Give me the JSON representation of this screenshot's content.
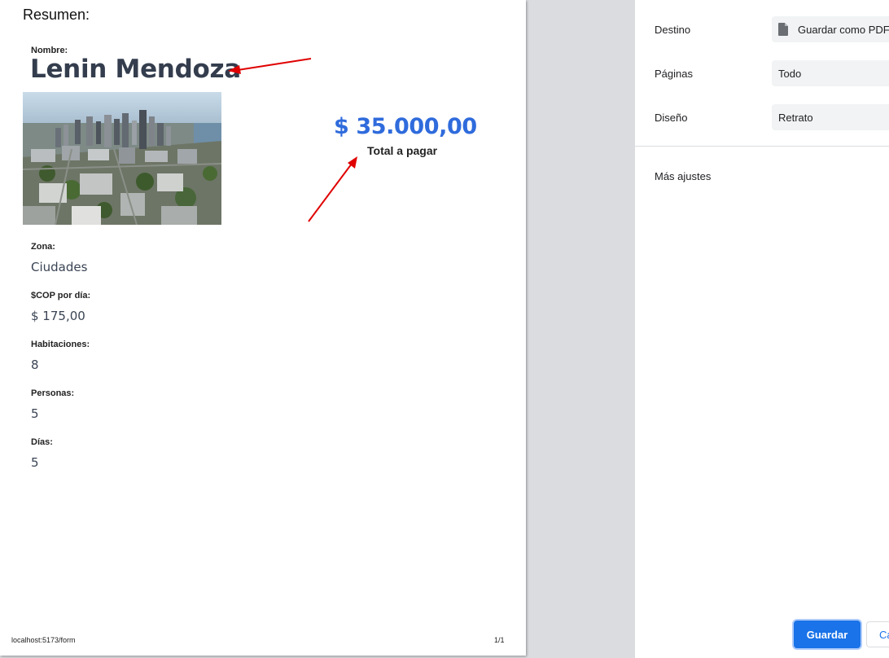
{
  "document": {
    "heading": "Resumen:",
    "name_label": "Nombre:",
    "name_value": "Lenin Mendoza",
    "total_amount": "$ 35.000,00",
    "total_label": "Total a pagar",
    "fields": [
      {
        "label": "Zona:",
        "value": "Ciudades"
      },
      {
        "label": "$COP por día:",
        "value": "$ 175,00"
      },
      {
        "label": "Habitaciones:",
        "value": "8"
      },
      {
        "label": "Personas:",
        "value": "5"
      },
      {
        "label": "Días:",
        "value": "5"
      }
    ],
    "image": "city-aerial-photo",
    "footer_url": "localhost:5173/form",
    "footer_page": "1/1"
  },
  "print_settings": {
    "destination_label": "Destino",
    "destination_value": "Guardar como PDF",
    "pages_label": "Páginas",
    "pages_value": "Todo",
    "layout_label": "Diseño",
    "layout_value": "Retrato",
    "more_settings": "Más ajustes",
    "save_button": "Guardar",
    "cancel_button": "Cancelar"
  },
  "colors": {
    "accent": "#1a73e8",
    "total_amount": "#2f6bdc",
    "annotation_arrow": "#e00000"
  }
}
